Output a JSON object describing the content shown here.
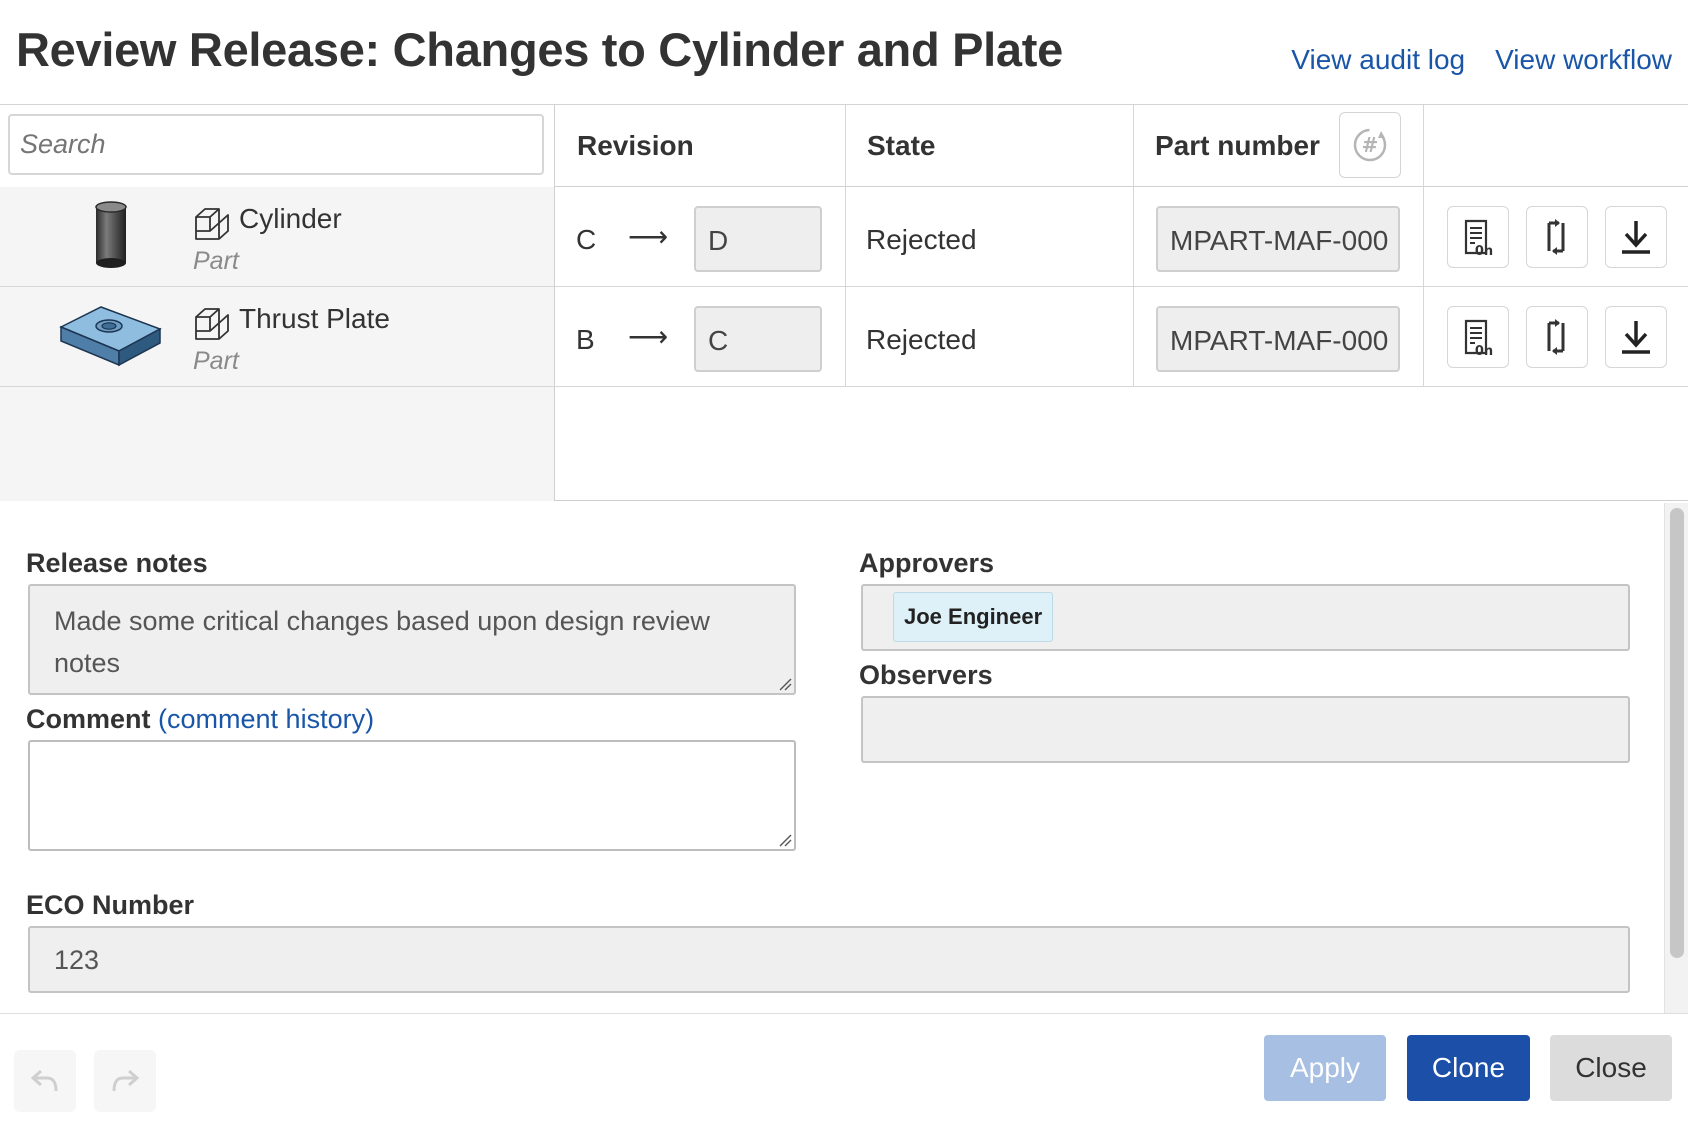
{
  "header": {
    "title": "Review Release: Changes to Cylinder and Plate",
    "audit_link": "View audit log",
    "workflow_link": "View workflow"
  },
  "table": {
    "search_placeholder": "Search",
    "columns": {
      "revision": "Revision",
      "state": "State",
      "part_number": "Part number"
    },
    "rows": [
      {
        "name": "Cylinder",
        "type": "Part",
        "rev_old": "C",
        "arrow": "⟶",
        "rev_new": "D",
        "state": "Rejected",
        "part_number": "MPART-MAF-000",
        "thumbnail": "cylinder"
      },
      {
        "name": "Thrust Plate",
        "type": "Part",
        "rev_old": "B",
        "arrow": "⟶",
        "rev_new": "C",
        "state": "Rejected",
        "part_number": "MPART-MAF-000",
        "thumbnail": "plate"
      }
    ],
    "row_actions": [
      "properties-icon",
      "compare-icon",
      "download-icon"
    ]
  },
  "form": {
    "release_notes_label": "Release notes",
    "release_notes_value": "Made some critical changes based upon design review notes",
    "comment_label": "Comment",
    "comment_history_link": "(comment history)",
    "comment_value": "",
    "approvers_label": "Approvers",
    "approvers": [
      "Joe Engineer"
    ],
    "observers_label": "Observers",
    "eco_label": "ECO Number",
    "eco_value": "123"
  },
  "footer": {
    "apply_label": "Apply",
    "clone_label": "Clone",
    "close_label": "Close"
  },
  "colors": {
    "link": "#1a56a8",
    "primary_button": "#1b4fa8",
    "disabled_button": "#a6bfe3",
    "secondary_button": "#dcdcdc",
    "approver_chip": "#dff1f8"
  }
}
